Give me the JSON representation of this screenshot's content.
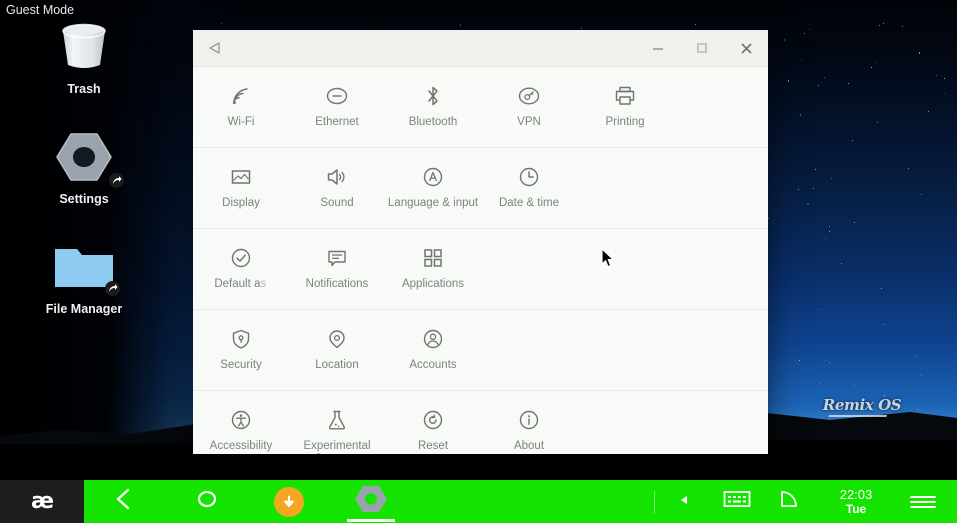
{
  "desktop": {
    "guest_mode_label": "Guest Mode",
    "watermark": "Remix OS",
    "icons": [
      {
        "name": "trash",
        "label": "Trash",
        "icon": "trash-bin-icon",
        "shortcut": false
      },
      {
        "name": "settings",
        "label": "Settings",
        "icon": "settings-hex-nut-icon",
        "shortcut": true
      },
      {
        "name": "file-manager",
        "label": "File Manager",
        "icon": "folder-icon",
        "shortcut": true
      }
    ]
  },
  "window": {
    "title": "",
    "back_icon": "back-triangle-icon",
    "controls": {
      "minimize": "minimize-icon",
      "maximize": "maximize-icon",
      "close": "close-icon"
    },
    "rows": [
      {
        "row": 1,
        "items": [
          {
            "label": "Wi-Fi",
            "icon": "wifi-icon"
          },
          {
            "label": "Ethernet",
            "icon": "ethernet-icon"
          },
          {
            "label": "Bluetooth",
            "icon": "bluetooth-icon"
          },
          {
            "label": "VPN",
            "icon": "vpn-key-icon"
          },
          {
            "label": "Printing",
            "icon": "printer-icon"
          }
        ]
      },
      {
        "row": 2,
        "items": [
          {
            "label": "Display",
            "icon": "display-picture-icon"
          },
          {
            "label": "Sound",
            "icon": "speaker-volume-icon"
          },
          {
            "label": "Language & input",
            "icon": "language-a-circle-icon"
          },
          {
            "label": "Date & time",
            "icon": "clock-icon"
          }
        ]
      },
      {
        "row": 3,
        "items": [
          {
            "label": "Default apps",
            "label_glitch_a": "Default a",
            "label_glitch_b": "s",
            "icon": "check-circle-icon",
            "glitched": true
          },
          {
            "label": "Notifications",
            "icon": "speech-bubble-icon"
          },
          {
            "label": "Applications",
            "icon": "grid-squares-icon"
          }
        ]
      },
      {
        "row": 4,
        "items": [
          {
            "label": "Security",
            "icon": "shield-lock-icon"
          },
          {
            "label": "Location",
            "icon": "location-pin-icon"
          },
          {
            "label": "Accounts",
            "icon": "account-person-icon"
          }
        ]
      },
      {
        "row": 5,
        "items": [
          {
            "label": "Accessibility",
            "icon": "accessibility-person-icon"
          },
          {
            "label": "Experimental features",
            "icon": "flask-icon"
          },
          {
            "label": "Reset",
            "icon": "reset-circle-arrow-icon"
          },
          {
            "label": "About",
            "icon": "info-circle-icon"
          }
        ]
      }
    ]
  },
  "taskbar": {
    "start_logo": "æ",
    "buttons": [
      {
        "name": "back",
        "icon": "back-chevron-icon"
      },
      {
        "name": "home",
        "icon": "home-circle-icon"
      },
      {
        "name": "downloads",
        "icon": "download-arrow-icon"
      },
      {
        "name": "settings",
        "icon": "settings-hex-nut-icon",
        "active": true
      }
    ],
    "tray": [
      {
        "name": "collapse",
        "icon": "collapse-triangle-icon"
      },
      {
        "name": "keyboard",
        "icon": "keyboard-icon"
      },
      {
        "name": "shape",
        "icon": "quarter-circle-icon"
      }
    ],
    "clock": {
      "time": "22:03",
      "day": "Tue"
    },
    "menu_icon": "hamburger-menu-icon"
  },
  "colors": {
    "taskbar_green": "#14e400",
    "start_dark": "#1d1d1d",
    "window_bg": "#f7faf7",
    "titlebar_bg": "#eef1ec",
    "download_orange": "#f5a623",
    "folder_blue": "#8ecbf0"
  }
}
